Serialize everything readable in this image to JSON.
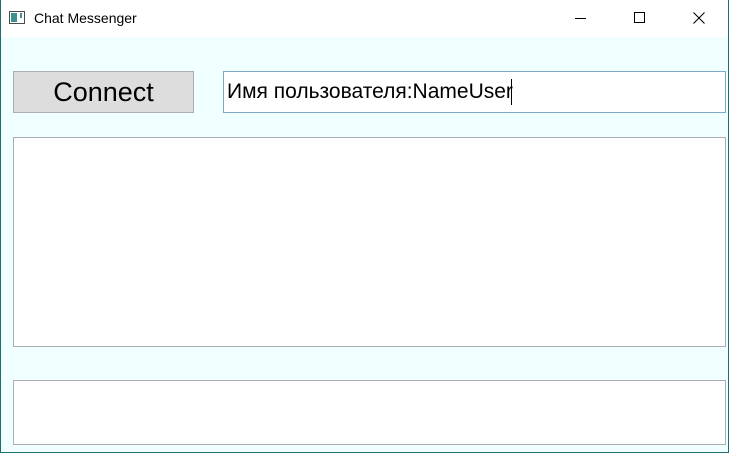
{
  "window": {
    "title": "Chat Messenger",
    "icon": "app-window-icon",
    "controls": {
      "minimize_icon": "minimize-icon",
      "maximize_icon": "maximize-icon",
      "close_icon": "close-icon"
    }
  },
  "toolbar": {
    "connect_label": "Connect"
  },
  "username": {
    "value": "Имя пользователя:NameUser"
  },
  "chat_log": {
    "text": ""
  },
  "message": {
    "value": ""
  },
  "colors": {
    "client_background": "#f0ffff",
    "button_background": "#dddddd",
    "input_border_focused": "#7ea8c6",
    "input_border": "#abadb3"
  }
}
